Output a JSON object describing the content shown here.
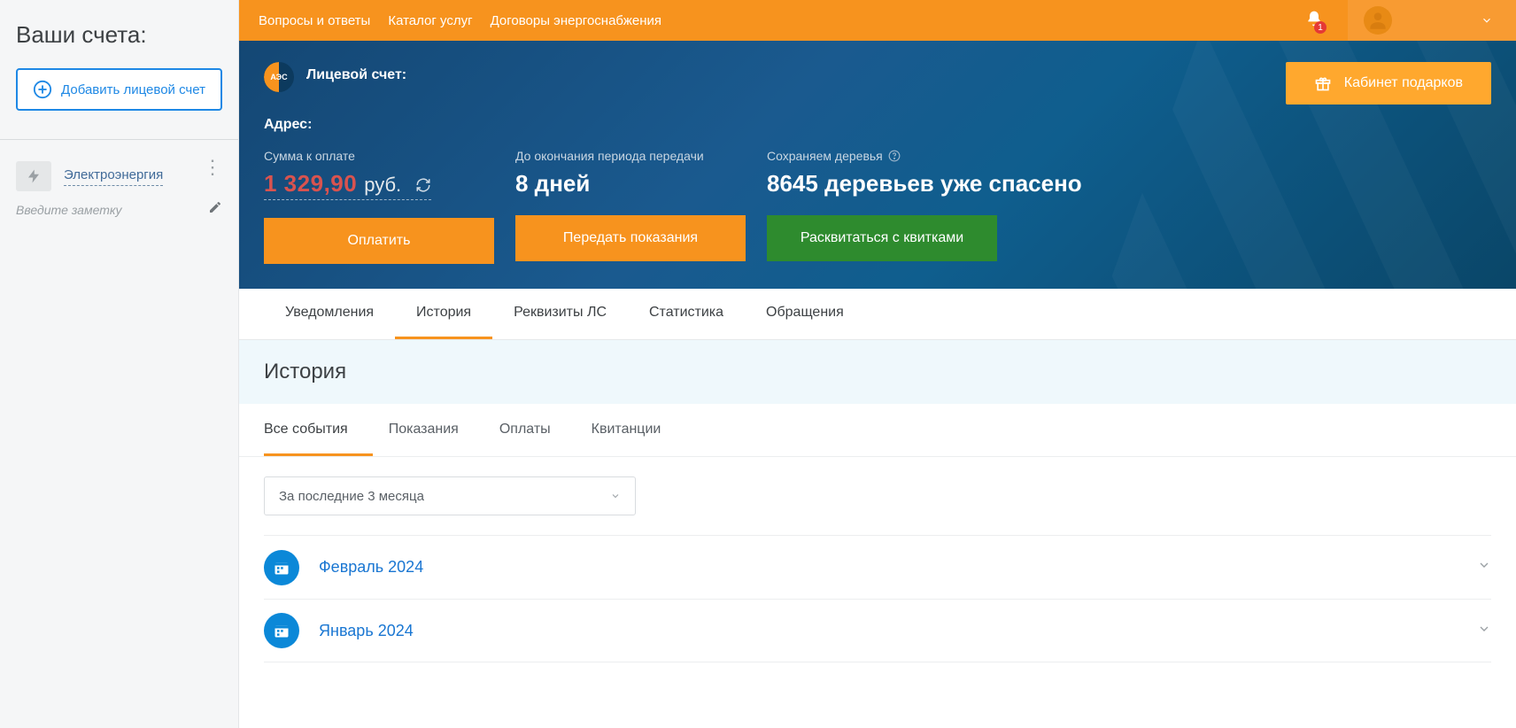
{
  "sidebar": {
    "title": "Ваши счета:",
    "add_account": "Добавить лицевой счет",
    "account_name": "Электроэнергия",
    "note_placeholder": "Введите заметку"
  },
  "topbar": {
    "links": [
      "Вопросы и ответы",
      "Каталог услуг",
      "Договоры энергоснабжения"
    ],
    "notif_count": "1"
  },
  "hero": {
    "logo_text": "АЭС",
    "account_label": "Лицевой счет:",
    "gifts_btn": "Кабинет подарков",
    "address_label": "Адрес:",
    "sum_label": "Сумма к оплате",
    "sum_value": "1 329,90",
    "sum_currency": "руб.",
    "days_label": "До окончания периода передачи",
    "days_value": "8 дней",
    "trees_label": "Сохраняем деревья",
    "trees_value": "8645 деревьев уже спасено",
    "pay_btn": "Оплатить",
    "submit_btn": "Передать показания",
    "receipts_btn": "Расквитаться с квитками"
  },
  "maintabs": [
    "Уведомления",
    "История",
    "Реквизиты ЛС",
    "Статистика",
    "Обращения"
  ],
  "maintabs_active": 1,
  "history_title": "История",
  "subtabs": [
    "Все события",
    "Показания",
    "Оплаты",
    "Квитанции"
  ],
  "subtabs_active": 0,
  "period_selected": "За последние 3 месяца",
  "months": [
    "Февраль 2024",
    "Январь 2024"
  ]
}
